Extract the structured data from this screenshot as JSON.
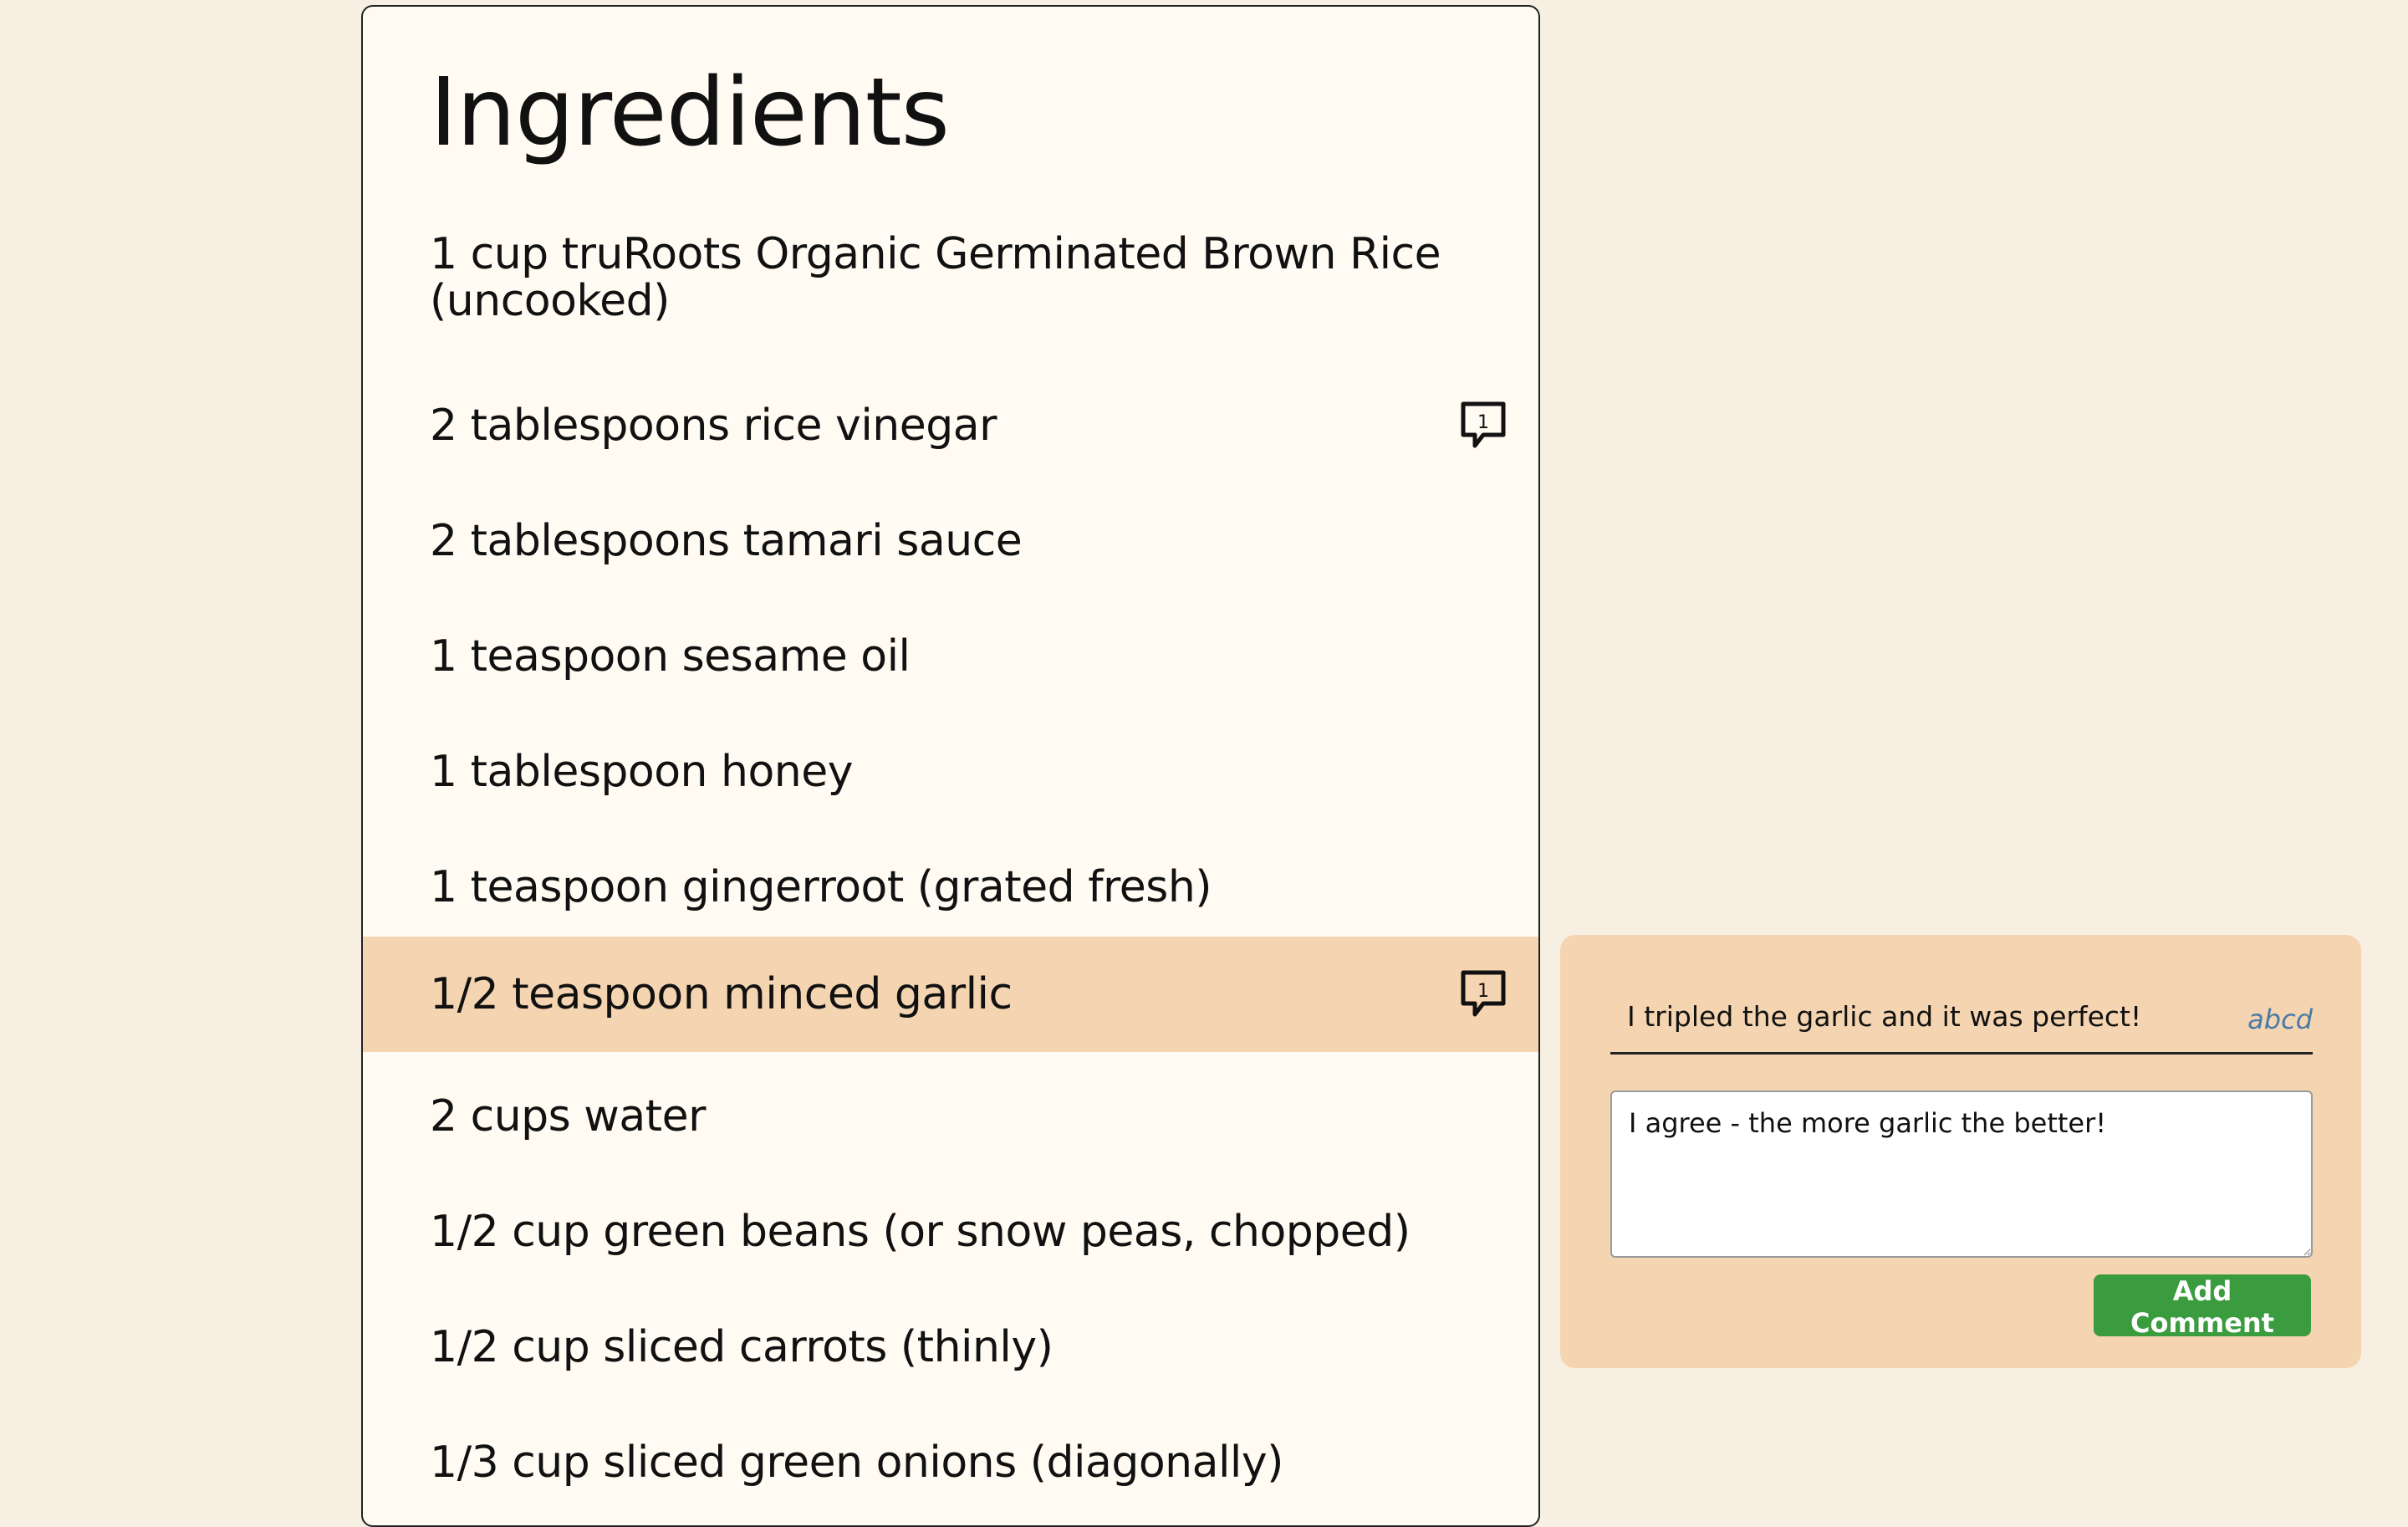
{
  "recipe": {
    "section_title": "Ingredients",
    "ingredients": [
      {
        "text": "1 cup truRoots Organic Germinated Brown Rice (uncooked)",
        "comment_count": ""
      },
      {
        "text": "2 tablespoons rice vinegar",
        "comment_count": "1"
      },
      {
        "text": "2 tablespoons tamari sauce",
        "comment_count": ""
      },
      {
        "text": "1 teaspoon sesame oil",
        "comment_count": ""
      },
      {
        "text": "1 tablespoon honey",
        "comment_count": ""
      },
      {
        "text": "1 teaspoon gingerroot (grated fresh)",
        "comment_count": ""
      },
      {
        "text": "1/2 teaspoon minced garlic",
        "comment_count": "1"
      },
      {
        "text": "2 cups water",
        "comment_count": ""
      },
      {
        "text": "1/2 cup green beans (or snow peas, chopped)",
        "comment_count": ""
      },
      {
        "text": "1/2 cup sliced carrots (thinly)",
        "comment_count": ""
      },
      {
        "text": "1/3 cup sliced green onions (diagonally)",
        "comment_count": ""
      }
    ],
    "selected_ingredient": "1/2 teaspoon minced garlic"
  },
  "comment_panel": {
    "comments": [
      {
        "text": "I tripled the garlic and it was perfect!",
        "author": "abcd"
      }
    ],
    "reply_value": "I agree - the more garlic the better!",
    "add_button_label": "Add Comment"
  },
  "colors": {
    "page_background": "#f7efe2",
    "card_background": "#fffbf2",
    "highlight": "#f5d5b1",
    "button": "#3a9c3e",
    "author_link": "#4a7aa6"
  },
  "icons": {
    "comment": "comment-bubble-icon"
  }
}
